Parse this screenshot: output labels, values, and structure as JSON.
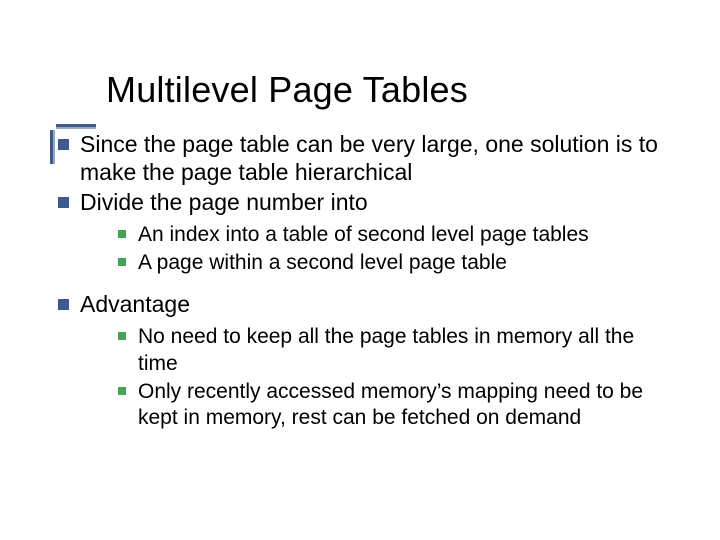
{
  "title": "Multilevel Page Tables",
  "bullets": {
    "p1": "Since the page table can be very large, one solution is to make the page table hierarchical",
    "p2": "Divide the page number into",
    "p2_sub": [
      "An index into a table of second level page tables",
      "A page within a second level page table"
    ],
    "p3": "Advantage",
    "p3_sub": [
      "No need to keep all the page tables in memory all the time",
      "Only recently accessed memory’s mapping need to be kept in memory, rest can be fetched on demand"
    ]
  }
}
